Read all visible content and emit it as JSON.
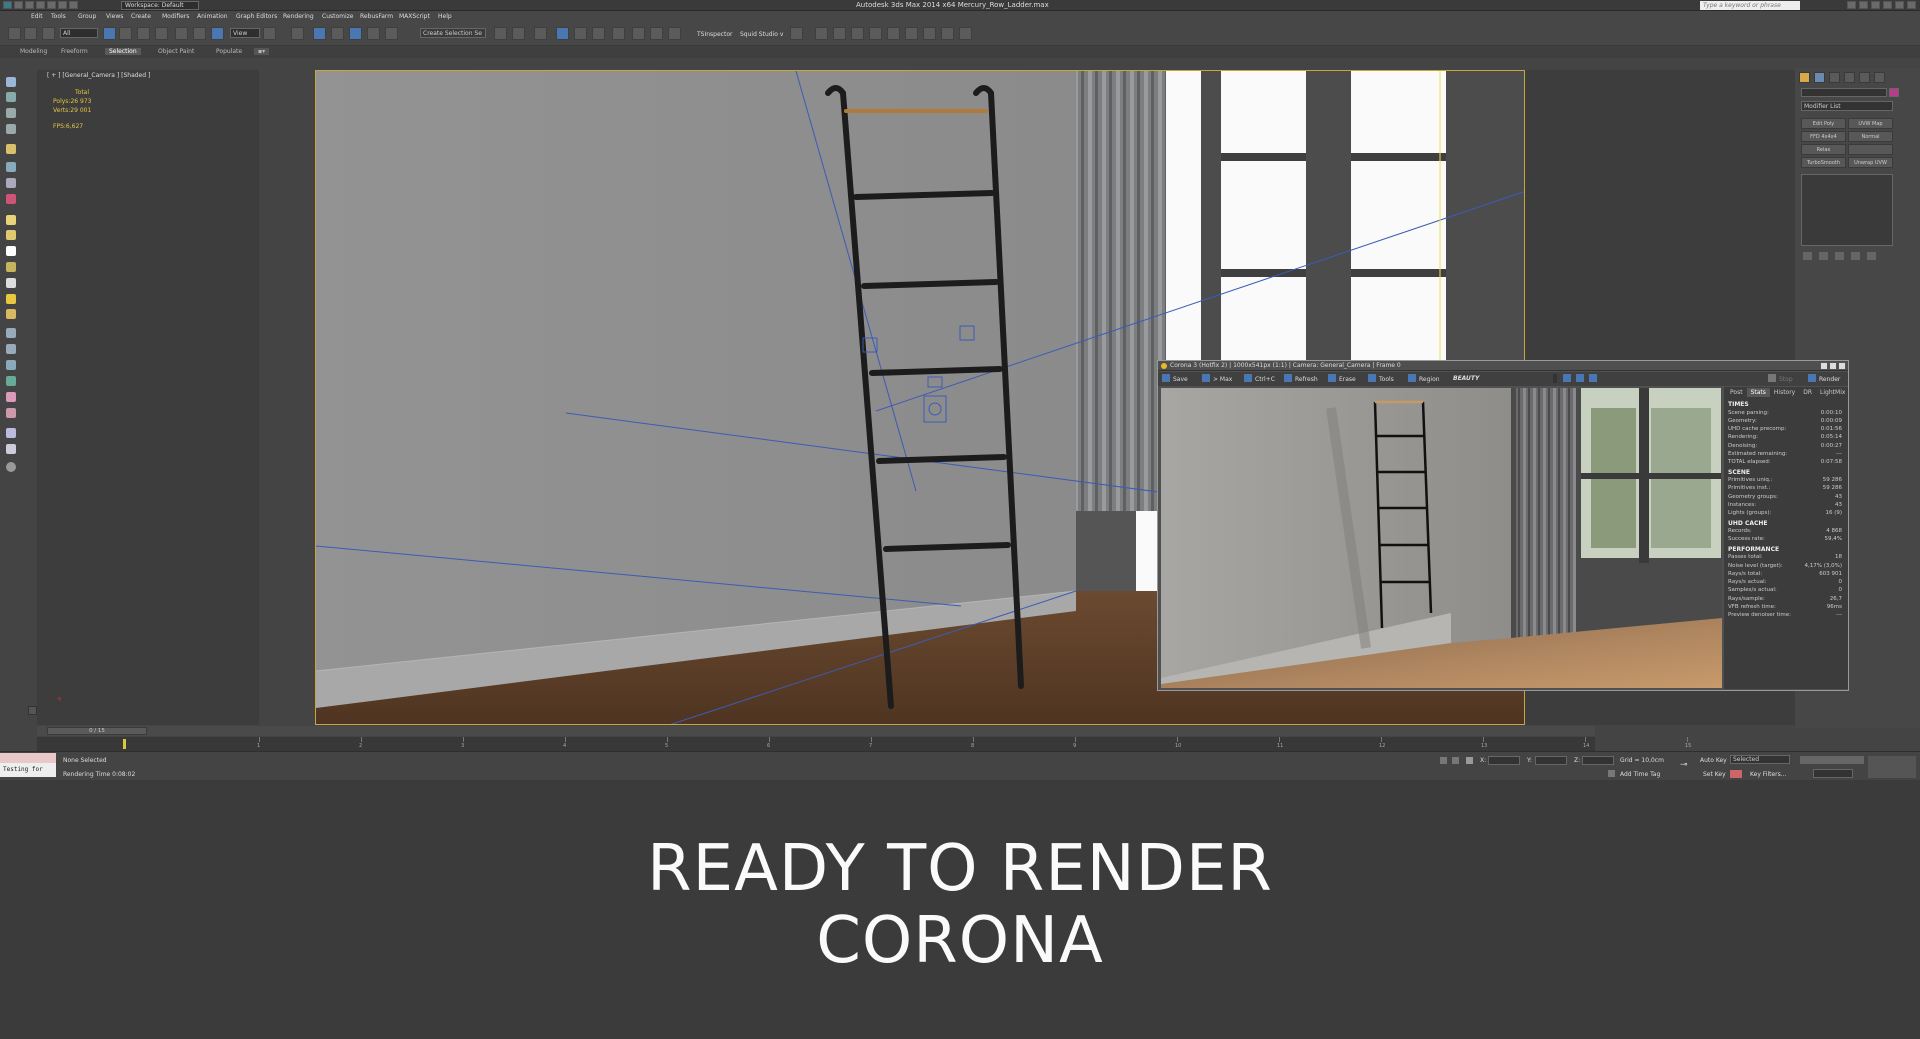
{
  "window": {
    "title": "Autodesk 3ds Max  2014 x64     Mercury_Row_Ladder.max",
    "workspace": "Workspace: Default",
    "search_placeholder": "Type a keyword or phrase"
  },
  "menu": [
    "Edit",
    "Tools",
    "Group",
    "Views",
    "Create",
    "Modifiers",
    "Animation",
    "Graph Editors",
    "Rendering",
    "Customize",
    "RebusFarm",
    "MAXScript",
    "Help"
  ],
  "toolbar": {
    "filter": "All",
    "ref_coord": "View",
    "selection_set": "Create Selection Se",
    "tsinspector": "TSInspector",
    "squid": "Squid Studio v"
  },
  "ribbon_tabs": [
    {
      "label": "Modeling",
      "active": false
    },
    {
      "label": "Freeform",
      "active": false
    },
    {
      "label": "Selection",
      "active": true
    },
    {
      "label": "Object Paint",
      "active": false
    },
    {
      "label": "Populate",
      "active": false
    }
  ],
  "viewport": {
    "label": "[ + ] [General_Camera ] [Shaded ]",
    "stats": {
      "total_label": "Total",
      "polys_label": "Polys:",
      "polys": "26 973",
      "verts_label": "Verts:",
      "verts": "29 001",
      "fps_label": "FPS:",
      "fps": "6,627"
    }
  },
  "command_panel": {
    "modifier_list": "Modifier List",
    "buttons": [
      "Edit Poly",
      "UVW Map",
      "FFD 4x4x4",
      "Normal",
      "Relax",
      "",
      "TurboSmooth",
      "Unwrap UVW"
    ]
  },
  "vfb": {
    "title": "Corona 3 (Hotfix 2) | 1000x541px (1:1) | Camera: General_Camera | Frame 0",
    "buttons": {
      "save": "Save",
      "max": "> Max",
      "ctrlc": "Ctrl+C",
      "refresh": "Refresh",
      "erase": "Erase",
      "tools": "Tools",
      "region": "Region",
      "pass": "BEAUTY",
      "stop": "Stop",
      "render": "Render"
    },
    "tabs": [
      {
        "label": "Post",
        "active": false
      },
      {
        "label": "Stats",
        "active": true
      },
      {
        "label": "History",
        "active": false
      },
      {
        "label": "DR",
        "active": false
      },
      {
        "label": "LightMix",
        "active": false
      }
    ],
    "sections": [
      {
        "title": "TIMES",
        "rows": [
          [
            "Scene parsing:",
            "0:00:10"
          ],
          [
            "Geometry:",
            "0:00:09"
          ],
          [
            "UHD cache precomp:",
            "0:01:56"
          ],
          [
            "Rendering:",
            "0:05:14"
          ],
          [
            "Denoising:",
            "0:00:27"
          ],
          [
            "Estimated remaining:",
            "---"
          ],
          [
            "TOTAL elapsed:",
            "0:07:58"
          ]
        ]
      },
      {
        "title": "SCENE",
        "rows": [
          [
            "Primitives uniq.:",
            "59 286"
          ],
          [
            "Primitives inst.:",
            "59 286"
          ],
          [
            "Geometry groups:",
            "43"
          ],
          [
            "Instances:",
            "43"
          ],
          [
            "Lights (groups):",
            "16 (9)"
          ]
        ]
      },
      {
        "title": "UHD CACHE",
        "rows": [
          [
            "Records:",
            "4 868"
          ],
          [
            "Success rate:",
            "59,4%"
          ]
        ]
      },
      {
        "title": "PERFORMANCE",
        "rows": [
          [
            "Passes total:",
            "18"
          ],
          [
            "Noise level (target):",
            "4,17% (3,0%)"
          ],
          [
            "Rays/s total:",
            "603 901"
          ],
          [
            "Rays/s actual:",
            "0"
          ],
          [
            "Samples/s actual:",
            "0"
          ],
          [
            "Rays/sample:",
            "26,7"
          ],
          [
            "VFB refresh time:",
            "96ms"
          ],
          [
            "Preview denoiser time:",
            "---"
          ]
        ]
      }
    ]
  },
  "timeline": {
    "frame": "0 / 15",
    "ticks": [
      "1",
      "2",
      "3",
      "4",
      "5",
      "6",
      "7",
      "8",
      "9",
      "10",
      "11",
      "12",
      "13",
      "14",
      "15"
    ]
  },
  "status": {
    "selection": "None Selected",
    "render_time": "Rendering Time  0:08:02",
    "maxscript": "Testing for",
    "grid": "Grid = 10,0cm",
    "add_time_tag": "Add Time Tag",
    "auto_key": "Auto Key",
    "set_key": "Set Key",
    "selected": "Selected",
    "key_filters": "Key Filters...",
    "x_label": "X:",
    "y_label": "Y:",
    "z_label": "Z:"
  },
  "caption": {
    "line1": "READY TO RENDER",
    "line2": "CORONA"
  }
}
